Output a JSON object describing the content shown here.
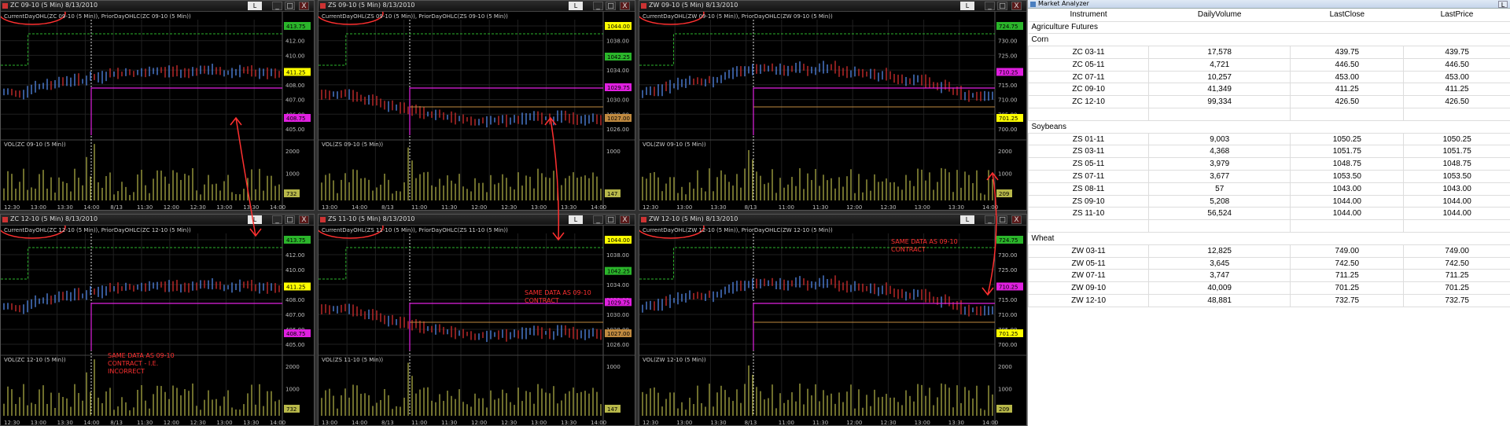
{
  "colors": {
    "price_up": "#4e7fd6",
    "price_down": "#c42b2b",
    "prior_high": "#2bb52b",
    "prior_low": "#e020e0",
    "prior_close": "#c08a40",
    "grid": "#202020",
    "axis_text": "#bfbfbf",
    "volume": "#b8b84a",
    "session_marker": "#e0e0e0",
    "annotation": "#ff3030"
  },
  "window_buttons": {
    "link": "L",
    "minimize": "_",
    "maximize": "□",
    "close": "X"
  },
  "charts": [
    {
      "id": "zc-0910",
      "title": "ZC 09-10 (5 Min)  8/13/2010",
      "indicator_label": "CurrentDayOHL(ZC 09-10 (5 Min)), PriorDayOHLC(ZC 09-10 (5 Min))",
      "volume_label": "VOL(ZC 09-10 (5 Min))",
      "price_ticks": [
        "413.00",
        "412.00",
        "410.00",
        "409.00",
        "408.00",
        "407.00",
        "406.00",
        "405.00"
      ],
      "price_markers": [
        {
          "label": "413.75",
          "color": "#2bb52b"
        },
        {
          "label": "411.25",
          "color": "#ffff00"
        },
        {
          "label": "408.75",
          "color": "#e020e0"
        }
      ],
      "volume_ticks": [
        "2000",
        "1000"
      ],
      "volume_marker": "732",
      "time_ticks": [
        "12:30",
        "13:00",
        "13:30",
        "14:00",
        "8/13",
        "11:30",
        "12:00",
        "12:30",
        "13:00",
        "13:30",
        "14:00"
      ],
      "annotation": ""
    },
    {
      "id": "zs-0910",
      "title": "ZS 09-10 (5 Min)  8/13/2010",
      "indicator_label": "CurrentDayOHL(ZS 09-10 (5 Min)), PriorDayOHLC(ZS 09-10 (5 Min))",
      "volume_label": "VOL(ZS 09-10 (5 Min))",
      "price_ticks": [
        "1040.00",
        "1038.00",
        "1036.00",
        "1034.00",
        "1032.00",
        "1030.00",
        "1028.00",
        "1026.00"
      ],
      "price_markers": [
        {
          "label": "1044.00",
          "color": "#ffff00"
        },
        {
          "label": "1042.25",
          "color": "#2bb52b"
        },
        {
          "label": "1029.75",
          "color": "#e020e0"
        },
        {
          "label": "1027.00",
          "color": "#c08a40"
        }
      ],
      "volume_ticks": [
        "1000"
      ],
      "volume_marker": "147",
      "time_ticks": [
        "13:00",
        "14:00",
        "8/13",
        "11:00",
        "11:30",
        "12:00",
        "12:30",
        "13:00",
        "13:30",
        "14:00"
      ],
      "annotation": ""
    },
    {
      "id": "zw-0910",
      "title": "ZW 09-10 (5 Min)  8/13/2010",
      "indicator_label": "CurrentDayOHL(ZW 09-10 (5 Min)), PriorDayOHLC(ZW 09-10 (5 Min))",
      "volume_label": "VOL(ZW 09-10 (5 Min))",
      "price_ticks": [
        "735.00",
        "730.00",
        "725.00",
        "720.00",
        "715.00",
        "710.00",
        "705.00",
        "700.00"
      ],
      "price_markers": [
        {
          "label": "724.75",
          "color": "#2bb52b"
        },
        {
          "label": "710.25",
          "color": "#e020e0"
        },
        {
          "label": "701.25",
          "color": "#ffff00"
        }
      ],
      "volume_ticks": [
        "2000",
        "1000"
      ],
      "volume_marker": "209",
      "time_ticks": [
        "12:30",
        "13:00",
        "13:30",
        "8/13",
        "11:00",
        "11:30",
        "12:00",
        "12:30",
        "13:00",
        "13:30",
        "14:00"
      ],
      "annotation": ""
    },
    {
      "id": "zc-1210",
      "title": "ZC 12-10 (5 Min)  8/13/2010",
      "indicator_label": "CurrentDayOHL(ZC 12-10 (5 Min)), PriorDayOHLC(ZC 12-10 (5 Min))",
      "volume_label": "VOL(ZC 12-10 (5 Min))",
      "price_ticks": [
        "413.00",
        "412.00",
        "410.00",
        "409.00",
        "408.00",
        "407.00",
        "406.00",
        "405.00"
      ],
      "price_markers": [
        {
          "label": "413.75",
          "color": "#2bb52b"
        },
        {
          "label": "411.25",
          "color": "#ffff00"
        },
        {
          "label": "408.75",
          "color": "#e020e0"
        }
      ],
      "volume_ticks": [
        "2000",
        "1000"
      ],
      "volume_marker": "732",
      "time_ticks": [
        "12:30",
        "13:00",
        "13:30",
        "14:00",
        "8/13",
        "11:30",
        "12:00",
        "12:30",
        "13:00",
        "13:30",
        "14:00"
      ],
      "annotation": "SAME DATA AS 09-10\nCONTRACT - I.E.\nINCORRECT"
    },
    {
      "id": "zs-1110",
      "title": "ZS 11-10 (5 Min)  8/13/2010",
      "indicator_label": "CurrentDayOHL(ZS 11-10 (5 Min)), PriorDayOHLC(ZS 11-10 (5 Min))",
      "volume_label": "VOL(ZS 11-10 (5 Min))",
      "price_ticks": [
        "1040.00",
        "1038.00",
        "1036.00",
        "1034.00",
        "1032.00",
        "1030.00",
        "1028.00",
        "1026.00"
      ],
      "price_markers": [
        {
          "label": "1044.00",
          "color": "#ffff00"
        },
        {
          "label": "1042.25",
          "color": "#2bb52b"
        },
        {
          "label": "1029.75",
          "color": "#e020e0"
        },
        {
          "label": "1027.00",
          "color": "#c08a40"
        }
      ],
      "volume_ticks": [
        "1000"
      ],
      "volume_marker": "147",
      "time_ticks": [
        "13:00",
        "14:00",
        "8/13",
        "11:00",
        "11:30",
        "12:00",
        "12:30",
        "13:00",
        "13:30",
        "14:00"
      ],
      "annotation": "SAME DATA AS 09-10\nCONTRACT"
    },
    {
      "id": "zw-1210",
      "title": "ZW 12-10 (5 Min)  8/13/2010",
      "indicator_label": "CurrentDayOHL(ZW 12-10 (5 Min)), PriorDayOHLC(ZW 12-10 (5 Min))",
      "volume_label": "VOL(ZW 12-10 (5 Min))",
      "price_ticks": [
        "735.00",
        "730.00",
        "725.00",
        "720.00",
        "715.00",
        "710.00",
        "705.00",
        "700.00"
      ],
      "price_markers": [
        {
          "label": "724.75",
          "color": "#2bb52b"
        },
        {
          "label": "710.25",
          "color": "#e020e0"
        },
        {
          "label": "701.25",
          "color": "#ffff00"
        }
      ],
      "volume_ticks": [
        "2000",
        "1000"
      ],
      "volume_marker": "209",
      "time_ticks": [
        "12:30",
        "13:00",
        "13:30",
        "8/13",
        "11:00",
        "11:30",
        "12:00",
        "12:30",
        "13:00",
        "13:30",
        "14:00"
      ],
      "annotation": "SAME DATA AS 09-10\nCONTRACT"
    }
  ],
  "market_analyzer": {
    "title": "Market Analyzer",
    "columns": [
      "Instrument",
      "DailyVolume",
      "LastClose",
      "LastPrice"
    ],
    "root_label": "Agriculture Futures",
    "groups": [
      {
        "name": "Corn",
        "rows": [
          [
            "ZC 03-11",
            "17,578",
            "439.75",
            "439.75"
          ],
          [
            "ZC 05-11",
            "4,721",
            "446.50",
            "446.50"
          ],
          [
            "ZC 07-11",
            "10,257",
            "453.00",
            "453.00"
          ],
          [
            "ZC 09-10",
            "41,349",
            "411.25",
            "411.25"
          ],
          [
            "ZC 12-10",
            "99,334",
            "426.50",
            "426.50"
          ]
        ]
      },
      {
        "name": "Soybeans",
        "rows": [
          [
            "ZS 01-11",
            "9,003",
            "1050.25",
            "1050.25"
          ],
          [
            "ZS 03-11",
            "4,368",
            "1051.75",
            "1051.75"
          ],
          [
            "ZS 05-11",
            "3,979",
            "1048.75",
            "1048.75"
          ],
          [
            "ZS 07-11",
            "3,677",
            "1053.50",
            "1053.50"
          ],
          [
            "ZS 08-11",
            "57",
            "1043.00",
            "1043.00"
          ],
          [
            "ZS 09-10",
            "5,208",
            "1044.00",
            "1044.00"
          ],
          [
            "ZS 11-10",
            "56,524",
            "1044.00",
            "1044.00"
          ]
        ]
      },
      {
        "name": "Wheat",
        "rows": [
          [
            "ZW 03-11",
            "12,825",
            "749.00",
            "749.00"
          ],
          [
            "ZW 05-11",
            "3,645",
            "742.50",
            "742.50"
          ],
          [
            "ZW 07-11",
            "3,747",
            "711.25",
            "711.25"
          ],
          [
            "ZW 09-10",
            "40,009",
            "701.25",
            "701.25"
          ],
          [
            "ZW 12-10",
            "48,881",
            "732.75",
            "732.75"
          ]
        ]
      }
    ]
  }
}
